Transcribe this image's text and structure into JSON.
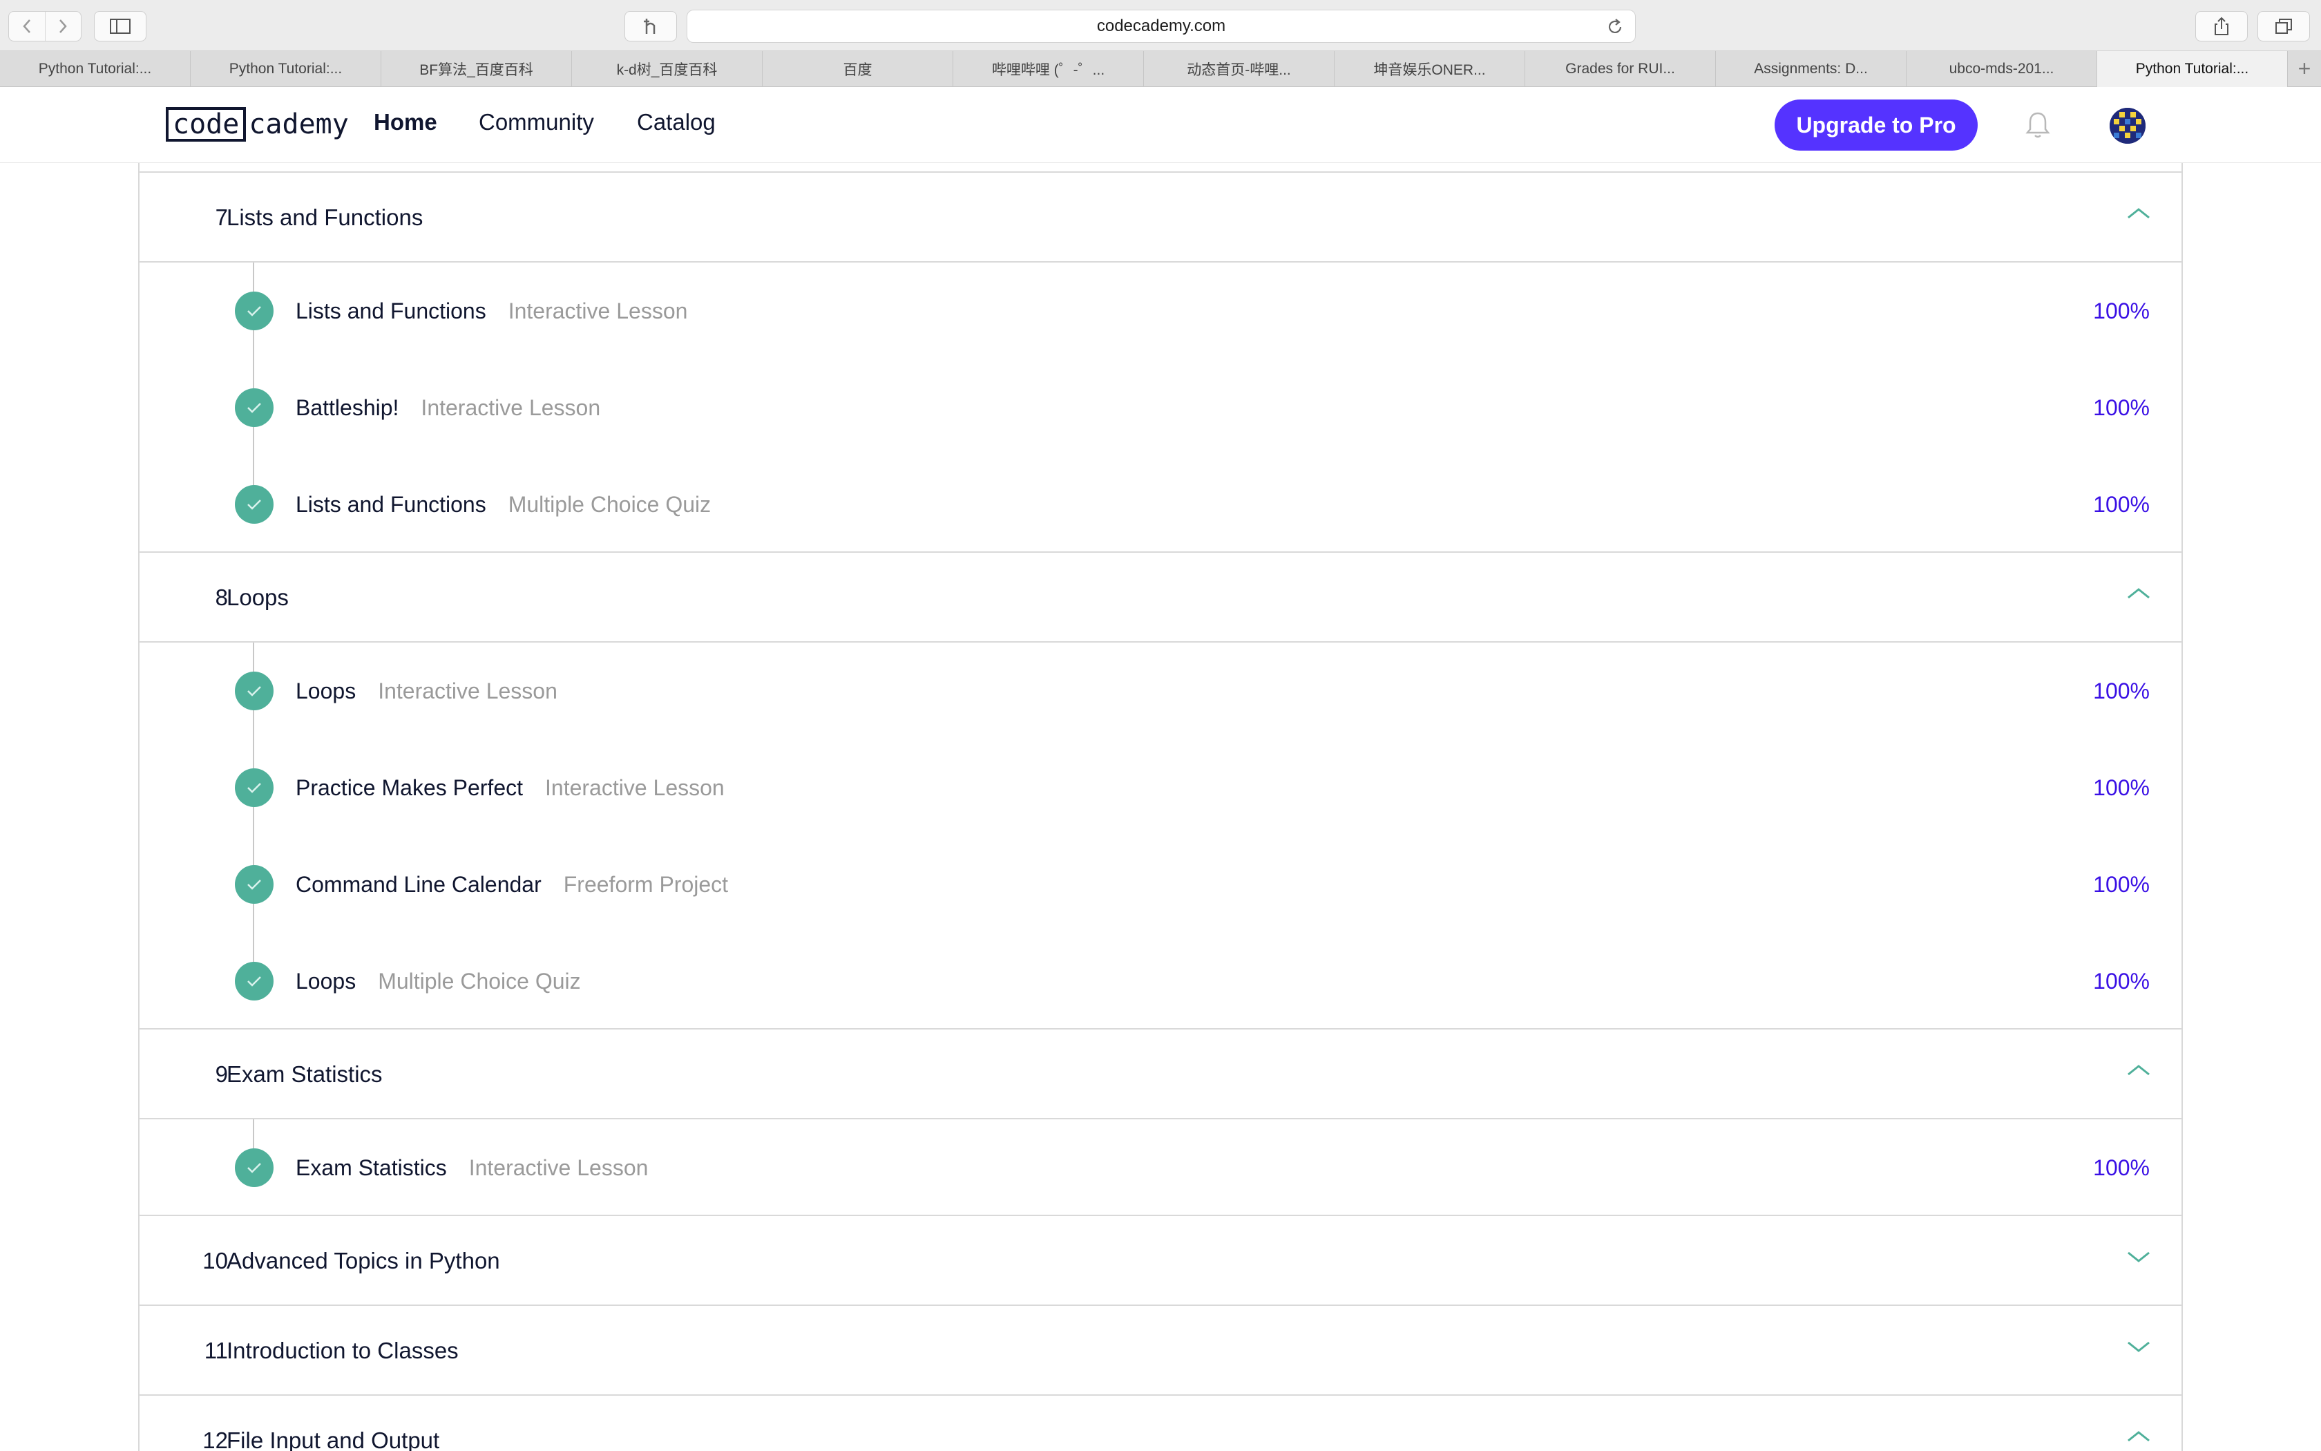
{
  "browser": {
    "url": "codecademy.com",
    "tabs": [
      {
        "label": "Python Tutorial:..."
      },
      {
        "label": "Python Tutorial:..."
      },
      {
        "label": "BF算法_百度百科"
      },
      {
        "label": "k-d树_百度百科"
      },
      {
        "label": "百度"
      },
      {
        "label": "哔哩哔哩 (゜-゜..."
      },
      {
        "label": "动态首页-哔哩..."
      },
      {
        "label": "坤音娱乐ONER..."
      },
      {
        "label": "Grades for RUI..."
      },
      {
        "label": "Assignments: D..."
      },
      {
        "label": "ubco-mds-201..."
      },
      {
        "label": "Python Tutorial:..."
      }
    ],
    "new_tab": "+"
  },
  "header": {
    "logo_box": "code",
    "logo_rest": "cademy",
    "nav": {
      "home": "Home",
      "community": "Community",
      "catalog": "Catalog"
    },
    "upgrade_label": "Upgrade to Pro"
  },
  "colors": {
    "accent": "#5533ff",
    "check": "#4fb09a",
    "percent": "#3a10e5"
  },
  "sections": [
    {
      "number": "7",
      "title": "Lists and Functions",
      "expanded": true,
      "items": [
        {
          "name": "Lists and Functions",
          "type": "Interactive Lesson",
          "progress": "100%"
        },
        {
          "name": "Battleship!",
          "type": "Interactive Lesson",
          "progress": "100%"
        },
        {
          "name": "Lists and Functions",
          "type": "Multiple Choice Quiz",
          "progress": "100%"
        }
      ]
    },
    {
      "number": "8",
      "title": "Loops",
      "expanded": true,
      "items": [
        {
          "name": "Loops",
          "type": "Interactive Lesson",
          "progress": "100%"
        },
        {
          "name": "Practice Makes Perfect",
          "type": "Interactive Lesson",
          "progress": "100%"
        },
        {
          "name": "Command Line Calendar",
          "type": "Freeform Project",
          "progress": "100%"
        },
        {
          "name": "Loops",
          "type": "Multiple Choice Quiz",
          "progress": "100%"
        }
      ]
    },
    {
      "number": "9",
      "title": "Exam Statistics",
      "expanded": true,
      "items": [
        {
          "name": "Exam Statistics",
          "type": "Interactive Lesson",
          "progress": "100%"
        }
      ]
    },
    {
      "number": "10",
      "title": "Advanced Topics in Python",
      "expanded": false,
      "items": []
    },
    {
      "number": "11",
      "title": "Introduction to Classes",
      "expanded": false,
      "items": []
    },
    {
      "number": "12",
      "title": "File Input and Output",
      "expanded": true,
      "items": []
    }
  ]
}
